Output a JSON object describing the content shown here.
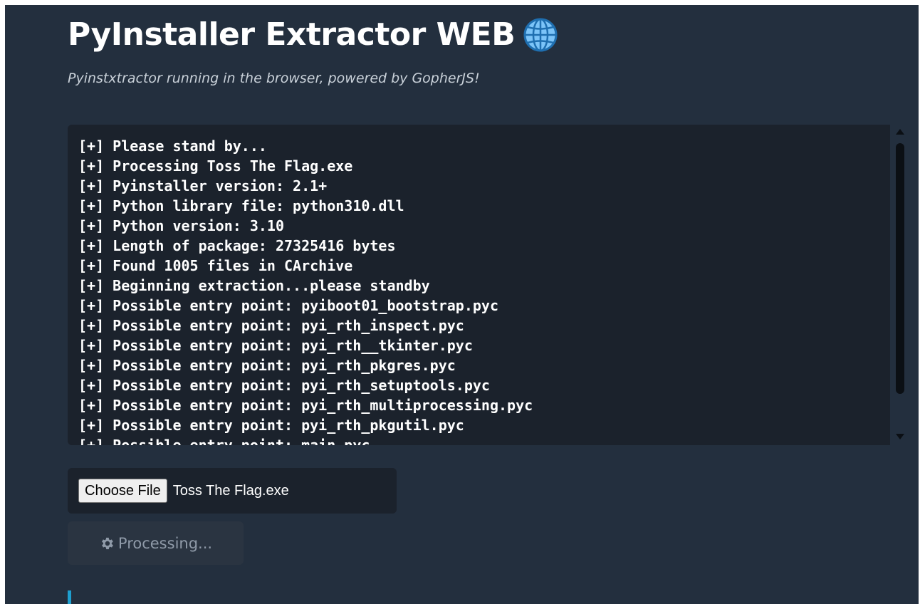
{
  "header": {
    "title": "PyInstaller Extractor WEB",
    "title_icon": "globe-icon",
    "subtitle": "Pyinstxtractor running in the browser, powered by GopherJS!"
  },
  "console": {
    "lines": [
      "[+] Please stand by...",
      "[+] Processing Toss The Flag.exe",
      "[+] Pyinstaller version: 2.1+",
      "[+] Python library file: python310.dll",
      "[+] Python version: 3.10",
      "[+] Length of package: 27325416 bytes",
      "[+] Found 1005 files in CArchive",
      "[+] Beginning extraction...please standby",
      "[+] Possible entry point: pyiboot01_bootstrap.pyc",
      "[+] Possible entry point: pyi_rth_inspect.pyc",
      "[+] Possible entry point: pyi_rth__tkinter.pyc",
      "[+] Possible entry point: pyi_rth_pkgres.pyc",
      "[+] Possible entry point: pyi_rth_setuptools.pyc",
      "[+] Possible entry point: pyi_rth_multiprocessing.pyc",
      "[+] Possible entry point: pyi_rth_pkgutil.pyc",
      "[+] Possible entry point: main.pyc"
    ]
  },
  "file_input": {
    "button_label": "Choose File",
    "selected_file": "Toss The Flag.exe"
  },
  "process_button": {
    "label": "Processing...",
    "icon": "gear-icon",
    "disabled": true
  },
  "colors": {
    "background": "#232f3e",
    "panel": "#1b222c",
    "globe": "#7cc4f8",
    "accent": "#1e9fcf"
  }
}
